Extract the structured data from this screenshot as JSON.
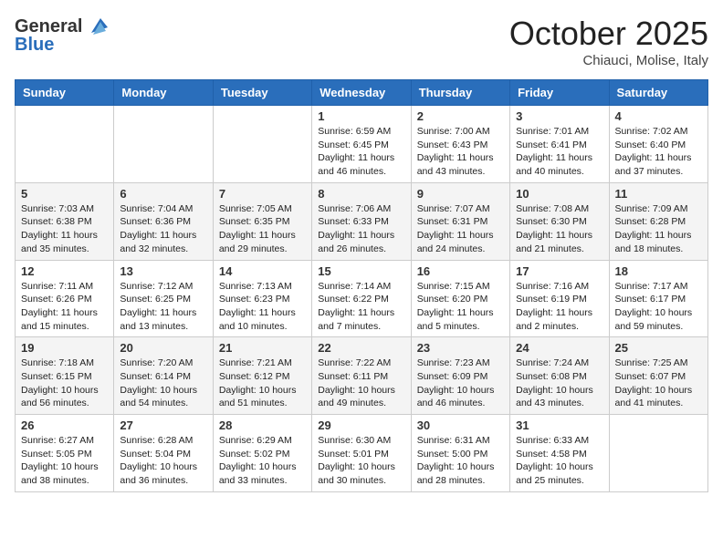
{
  "header": {
    "logo_line1": "General",
    "logo_line2": "Blue",
    "month_title": "October 2025",
    "location": "Chiauci, Molise, Italy"
  },
  "days_of_week": [
    "Sunday",
    "Monday",
    "Tuesday",
    "Wednesday",
    "Thursday",
    "Friday",
    "Saturday"
  ],
  "weeks": [
    [
      {
        "day": "",
        "info": ""
      },
      {
        "day": "",
        "info": ""
      },
      {
        "day": "",
        "info": ""
      },
      {
        "day": "1",
        "info": "Sunrise: 6:59 AM\nSunset: 6:45 PM\nDaylight: 11 hours and 46 minutes."
      },
      {
        "day": "2",
        "info": "Sunrise: 7:00 AM\nSunset: 6:43 PM\nDaylight: 11 hours and 43 minutes."
      },
      {
        "day": "3",
        "info": "Sunrise: 7:01 AM\nSunset: 6:41 PM\nDaylight: 11 hours and 40 minutes."
      },
      {
        "day": "4",
        "info": "Sunrise: 7:02 AM\nSunset: 6:40 PM\nDaylight: 11 hours and 37 minutes."
      }
    ],
    [
      {
        "day": "5",
        "info": "Sunrise: 7:03 AM\nSunset: 6:38 PM\nDaylight: 11 hours and 35 minutes."
      },
      {
        "day": "6",
        "info": "Sunrise: 7:04 AM\nSunset: 6:36 PM\nDaylight: 11 hours and 32 minutes."
      },
      {
        "day": "7",
        "info": "Sunrise: 7:05 AM\nSunset: 6:35 PM\nDaylight: 11 hours and 29 minutes."
      },
      {
        "day": "8",
        "info": "Sunrise: 7:06 AM\nSunset: 6:33 PM\nDaylight: 11 hours and 26 minutes."
      },
      {
        "day": "9",
        "info": "Sunrise: 7:07 AM\nSunset: 6:31 PM\nDaylight: 11 hours and 24 minutes."
      },
      {
        "day": "10",
        "info": "Sunrise: 7:08 AM\nSunset: 6:30 PM\nDaylight: 11 hours and 21 minutes."
      },
      {
        "day": "11",
        "info": "Sunrise: 7:09 AM\nSunset: 6:28 PM\nDaylight: 11 hours and 18 minutes."
      }
    ],
    [
      {
        "day": "12",
        "info": "Sunrise: 7:11 AM\nSunset: 6:26 PM\nDaylight: 11 hours and 15 minutes."
      },
      {
        "day": "13",
        "info": "Sunrise: 7:12 AM\nSunset: 6:25 PM\nDaylight: 11 hours and 13 minutes."
      },
      {
        "day": "14",
        "info": "Sunrise: 7:13 AM\nSunset: 6:23 PM\nDaylight: 11 hours and 10 minutes."
      },
      {
        "day": "15",
        "info": "Sunrise: 7:14 AM\nSunset: 6:22 PM\nDaylight: 11 hours and 7 minutes."
      },
      {
        "day": "16",
        "info": "Sunrise: 7:15 AM\nSunset: 6:20 PM\nDaylight: 11 hours and 5 minutes."
      },
      {
        "day": "17",
        "info": "Sunrise: 7:16 AM\nSunset: 6:19 PM\nDaylight: 11 hours and 2 minutes."
      },
      {
        "day": "18",
        "info": "Sunrise: 7:17 AM\nSunset: 6:17 PM\nDaylight: 10 hours and 59 minutes."
      }
    ],
    [
      {
        "day": "19",
        "info": "Sunrise: 7:18 AM\nSunset: 6:15 PM\nDaylight: 10 hours and 56 minutes."
      },
      {
        "day": "20",
        "info": "Sunrise: 7:20 AM\nSunset: 6:14 PM\nDaylight: 10 hours and 54 minutes."
      },
      {
        "day": "21",
        "info": "Sunrise: 7:21 AM\nSunset: 6:12 PM\nDaylight: 10 hours and 51 minutes."
      },
      {
        "day": "22",
        "info": "Sunrise: 7:22 AM\nSunset: 6:11 PM\nDaylight: 10 hours and 49 minutes."
      },
      {
        "day": "23",
        "info": "Sunrise: 7:23 AM\nSunset: 6:09 PM\nDaylight: 10 hours and 46 minutes."
      },
      {
        "day": "24",
        "info": "Sunrise: 7:24 AM\nSunset: 6:08 PM\nDaylight: 10 hours and 43 minutes."
      },
      {
        "day": "25",
        "info": "Sunrise: 7:25 AM\nSunset: 6:07 PM\nDaylight: 10 hours and 41 minutes."
      }
    ],
    [
      {
        "day": "26",
        "info": "Sunrise: 6:27 AM\nSunset: 5:05 PM\nDaylight: 10 hours and 38 minutes."
      },
      {
        "day": "27",
        "info": "Sunrise: 6:28 AM\nSunset: 5:04 PM\nDaylight: 10 hours and 36 minutes."
      },
      {
        "day": "28",
        "info": "Sunrise: 6:29 AM\nSunset: 5:02 PM\nDaylight: 10 hours and 33 minutes."
      },
      {
        "day": "29",
        "info": "Sunrise: 6:30 AM\nSunset: 5:01 PM\nDaylight: 10 hours and 30 minutes."
      },
      {
        "day": "30",
        "info": "Sunrise: 6:31 AM\nSunset: 5:00 PM\nDaylight: 10 hours and 28 minutes."
      },
      {
        "day": "31",
        "info": "Sunrise: 6:33 AM\nSunset: 4:58 PM\nDaylight: 10 hours and 25 minutes."
      },
      {
        "day": "",
        "info": ""
      }
    ]
  ]
}
